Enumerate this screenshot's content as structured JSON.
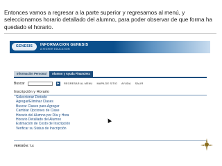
{
  "caption": "Entonces vamos a regresar a la parte superior y regresamos al menú, y seleccionamos  horario detallado del alumno, para poder observar de que forma ha quedado el horario.",
  "header": {
    "logo_text": "GENESIS",
    "brand_title": "INFORMACION GENESIS",
    "brand_subtitle": "A HIGHER EDUCATION"
  },
  "tabs": [
    {
      "label": "Información Personal"
    },
    {
      "label": "Alumno y Ayuda Financiera"
    }
  ],
  "toolbar": {
    "search_label": "Buscar",
    "go_symbol": "►",
    "links": [
      "REGRESAR AL MENU",
      "MAPA DE SITIO",
      "AYUDA",
      "SALIR"
    ]
  },
  "section": {
    "title": "Inscripción y Horario",
    "items": [
      "Seleccionar Periodo",
      "Agregar/Eliminar Clases",
      "Buscar Clases para Agregar",
      "Cambiar Opciones de Clase",
      "Horario del Alumno por Día y Hora",
      "Horario Detallado del Alumno",
      "Estimación de Costo de Inscripción",
      "Verificar su Status de Inscripción"
    ]
  },
  "footer": {
    "version": "VERSIÓN: 7.4"
  },
  "colors": {
    "banner": "#0b4f8c",
    "active_tab": "#1d4e7e",
    "link": "#1f4f86"
  }
}
